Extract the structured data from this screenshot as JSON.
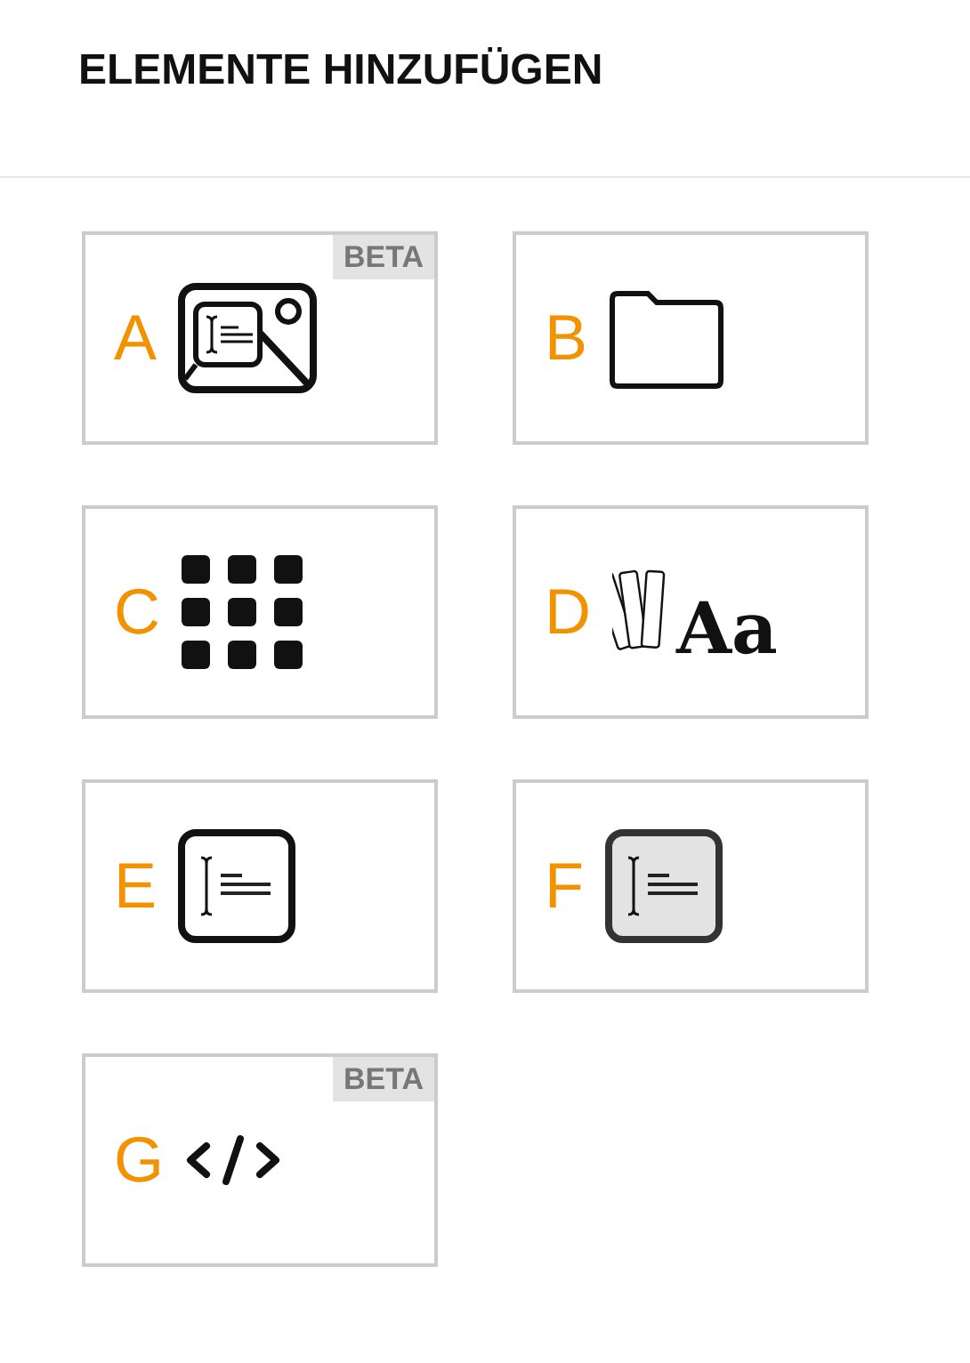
{
  "header": {
    "title": "ELEMENTE HINZUFÜGEN"
  },
  "tiles": [
    {
      "letter": "A",
      "kind": "image-text",
      "badge": "BETA"
    },
    {
      "letter": "B",
      "kind": "folder"
    },
    {
      "letter": "C",
      "kind": "grid"
    },
    {
      "letter": "D",
      "kind": "typography",
      "icon_text": "Aa"
    },
    {
      "letter": "E",
      "kind": "textbox"
    },
    {
      "letter": "F",
      "kind": "textbox-shaded"
    },
    {
      "letter": "G",
      "kind": "code",
      "badge": "BETA"
    }
  ]
}
